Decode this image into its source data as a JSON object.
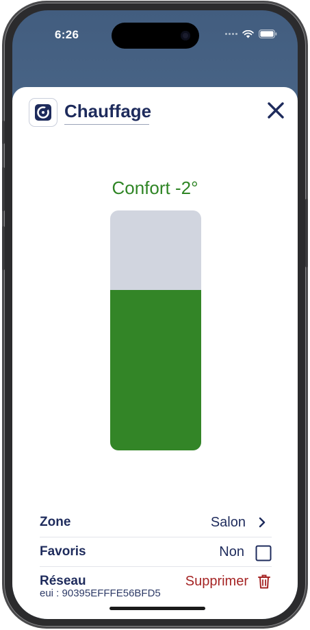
{
  "status_bar": {
    "time": "6:26",
    "icons": [
      "cellular-signal-icon",
      "wifi-icon",
      "battery-icon"
    ]
  },
  "header": {
    "app_icon": "thermostat-icon",
    "title": "Chauffage",
    "close_icon": "close-icon"
  },
  "heating": {
    "mode_label": "Confort -2°",
    "level_fraction": 0.67,
    "fill_color": "#338527",
    "track_color": "#d1d5df"
  },
  "details": {
    "zone": {
      "label": "Zone",
      "value": "Salon",
      "icon": "chevron-right-icon"
    },
    "favoris": {
      "label": "Favoris",
      "value": "Non",
      "icon": "checkbox-icon"
    },
    "reseau": {
      "label": "Réseau",
      "action": "Supprimer",
      "icon": "trash-icon",
      "action_color": "#a52424"
    },
    "eui": "eui : 90395EFFFE56BFD5"
  },
  "colors": {
    "primary": "#1e2b5c",
    "accent_green": "#2f8525",
    "danger": "#a52424"
  }
}
